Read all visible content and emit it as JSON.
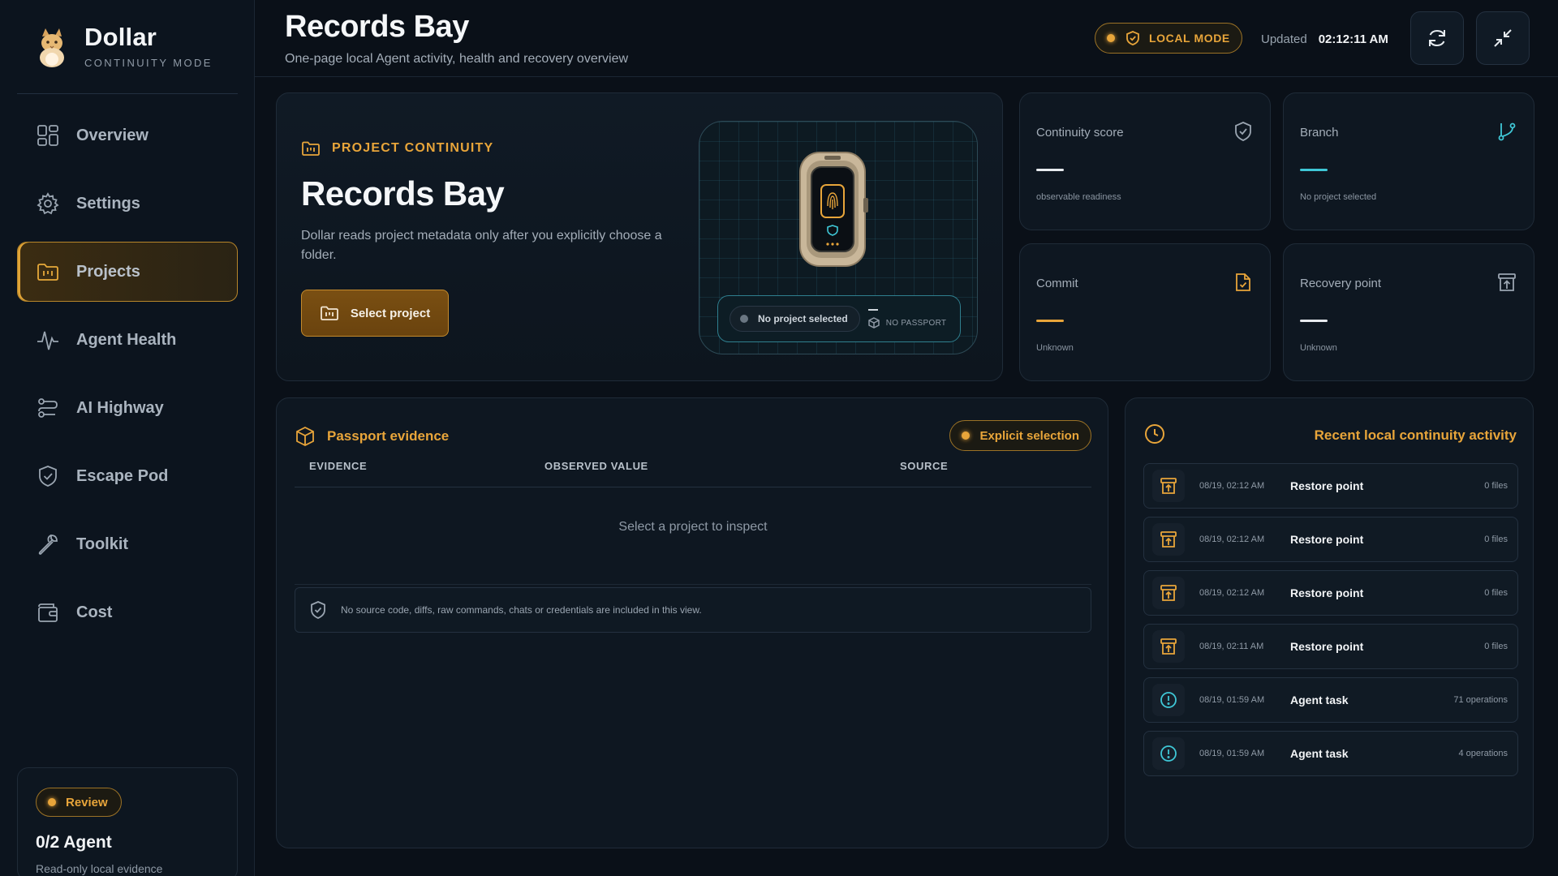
{
  "brand": {
    "name": "Dollar",
    "subtitle": "CONTINUITY MODE"
  },
  "sidebar": {
    "items": [
      {
        "label": "Overview",
        "icon": "grid-icon",
        "active": false
      },
      {
        "label": "Settings",
        "icon": "gear-icon",
        "active": false
      },
      {
        "label": "Projects",
        "icon": "folder-icon",
        "active": true
      },
      {
        "label": "Agent Health",
        "icon": "pulse-icon",
        "active": false
      },
      {
        "label": "AI Highway",
        "icon": "route-icon",
        "active": false
      },
      {
        "label": "Escape Pod",
        "icon": "shield-icon",
        "active": false
      },
      {
        "label": "Toolkit",
        "icon": "wrench-icon",
        "active": false
      },
      {
        "label": "Cost",
        "icon": "wallet-icon",
        "active": false
      }
    ],
    "review": {
      "badge": "Review",
      "title": "0/2 Agent",
      "subtitle": "Read-only local evidence"
    }
  },
  "header": {
    "title": "Records Bay",
    "subtitle": "One-page local Agent activity, health and recovery overview",
    "mode_badge": "LOCAL MODE",
    "updated_label": "Updated",
    "updated_time": "02:12:11 AM"
  },
  "hero": {
    "eyebrow": "PROJECT CONTINUITY",
    "title": "Records Bay",
    "description": "Dollar reads project metadata only after you explicitly choose a folder.",
    "select_button": "Select project",
    "status_pill": "No project selected",
    "passport_dash": "—",
    "passport_label": "NO PASSPORT"
  },
  "stats": {
    "continuity": {
      "label": "Continuity score",
      "value": "—",
      "sub": "observable readiness"
    },
    "branch": {
      "label": "Branch",
      "value": "—",
      "sub": "No project selected"
    },
    "commit": {
      "label": "Commit",
      "value": "—",
      "sub": "Unknown"
    },
    "recovery": {
      "label": "Recovery point",
      "value": "—",
      "sub": "Unknown"
    }
  },
  "evidence": {
    "title": "Passport evidence",
    "badge": "Explicit selection",
    "columns": [
      "EVIDENCE",
      "OBSERVED VALUE",
      "SOURCE"
    ],
    "empty": "Select a project to inspect",
    "notice": "No source code, diffs, raw commands, chats or credentials are included in this view."
  },
  "activity": {
    "title": "Recent local continuity activity",
    "items": [
      {
        "time": "08/19, 02:12 AM",
        "name": "Restore point",
        "count": "0 files",
        "kind": "restore"
      },
      {
        "time": "08/19, 02:12 AM",
        "name": "Restore point",
        "count": "0 files",
        "kind": "restore"
      },
      {
        "time": "08/19, 02:12 AM",
        "name": "Restore point",
        "count": "0 files",
        "kind": "restore"
      },
      {
        "time": "08/19, 02:11 AM",
        "name": "Restore point",
        "count": "0 files",
        "kind": "restore"
      },
      {
        "time": "08/19, 01:59 AM",
        "name": "Agent task",
        "count": "71 operations",
        "kind": "task"
      },
      {
        "time": "08/19, 01:59 AM",
        "name": "Agent task",
        "count": "4 operations",
        "kind": "task"
      }
    ]
  },
  "colors": {
    "accent": "#e8a53a",
    "teal": "#3fc7d6",
    "bg": "#0a1018"
  }
}
